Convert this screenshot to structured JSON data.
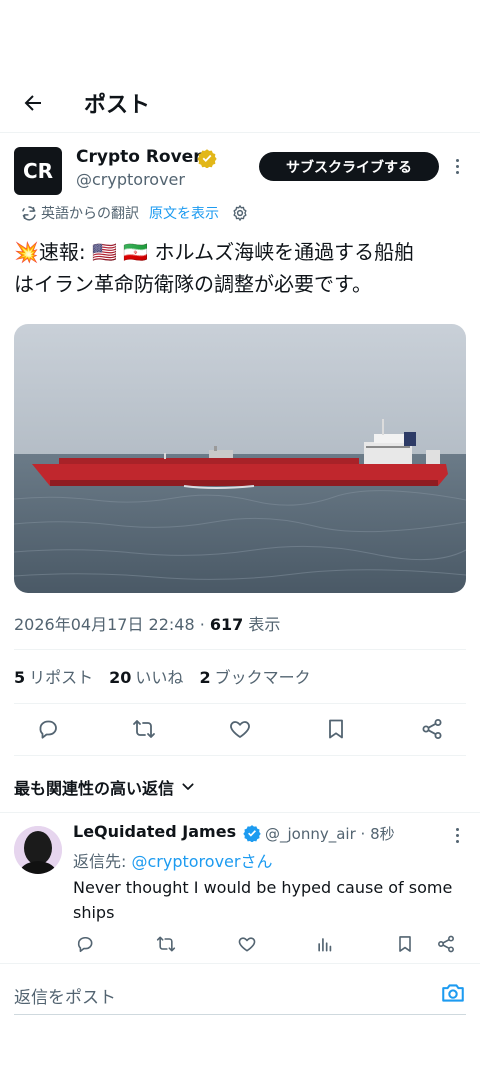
{
  "header": {
    "title": "ポスト"
  },
  "author": {
    "avatar_text": "CR",
    "name": "Crypto Rover",
    "handle": "@cryptorover",
    "subscribe_label": "サブスクライブする"
  },
  "translation": {
    "note": "英語からの翻訳",
    "show_original": "原文を表示"
  },
  "tweet": {
    "text_line1": "💥速報: 🇺🇸 🇮🇷 ホルムズ海峡を通過する船舶",
    "text_line2": "はイラン革命防衛隊の調整が必要です。",
    "timestamp": "2026年04月17日 22:48 · ",
    "views": "617",
    "views_label": " 表示"
  },
  "stats": {
    "reposts_num": "5",
    "reposts_label": "リポスト",
    "likes_num": "20",
    "likes_label": "いいね",
    "bookmarks_num": "2",
    "bookmarks_label": "ブックマーク"
  },
  "sort": {
    "label": "最も関連性の高い返信"
  },
  "reply": {
    "name": "LeQuidated James",
    "meta": "@_jonny_air · 8秒",
    "reply_to_prefix": "返信先: ",
    "reply_to_handle": "@cryptoroverさん",
    "text": "Never thought I would be hyped cause of some ships"
  },
  "compose": {
    "placeholder": "返信をポスト"
  },
  "colors": {
    "accent": "#1d9bf0",
    "text": "#0f1419",
    "muted": "#536471",
    "verified": "#e2b719"
  }
}
